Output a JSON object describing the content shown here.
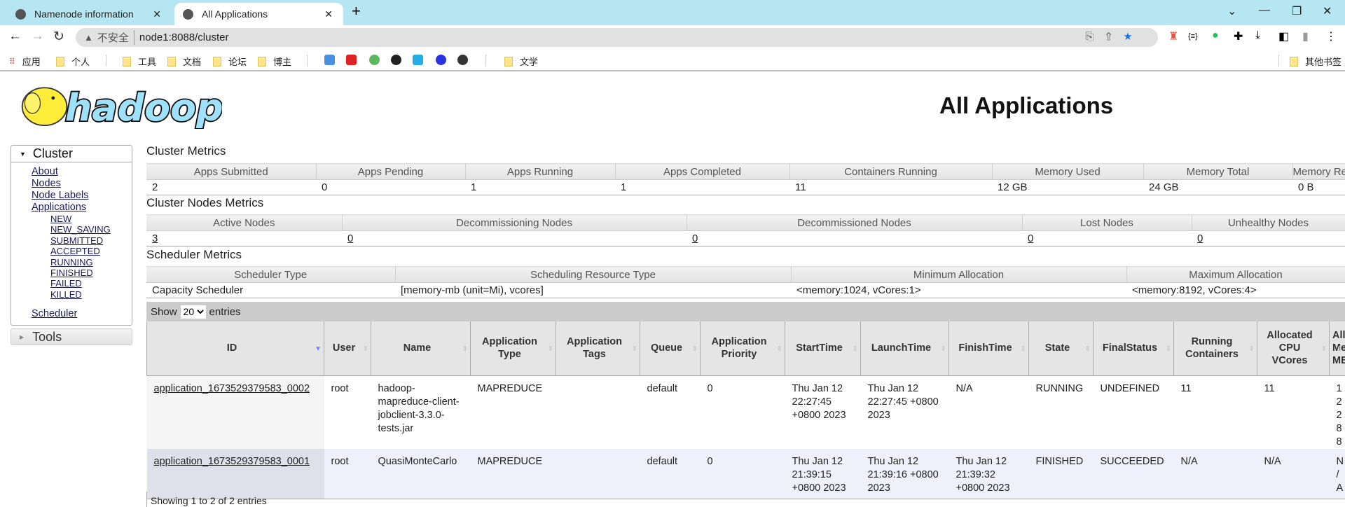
{
  "browser": {
    "tabs": [
      {
        "title": "Namenode information"
      },
      {
        "title": "All Applications",
        "active": true
      }
    ],
    "insecure_label": "不安全",
    "url": "node1:8088/cluster",
    "bookmarks": [
      "应用",
      "个人",
      "工具",
      "文档",
      "论坛",
      "博主",
      "文学"
    ],
    "other_bookmarks": "其他书签"
  },
  "page": {
    "title": "All Applications",
    "logo_text": "hadoop"
  },
  "sidebar": {
    "cluster_label": "Cluster",
    "links": [
      "About",
      "Nodes",
      "Node Labels",
      "Applications"
    ],
    "app_states": [
      "NEW",
      "NEW_SAVING",
      "SUBMITTED",
      "ACCEPTED",
      "RUNNING",
      "FINISHED",
      "FAILED",
      "KILLED"
    ],
    "scheduler": "Scheduler",
    "tools_label": "Tools"
  },
  "cluster_metrics": {
    "title": "Cluster Metrics",
    "headers": [
      "Apps Submitted",
      "Apps Pending",
      "Apps Running",
      "Apps Completed",
      "Containers Running",
      "Memory Used",
      "Memory Total",
      "Memory Reserved"
    ],
    "values": [
      "2",
      "0",
      "1",
      "1",
      "11",
      "12 GB",
      "24 GB",
      "0 B"
    ]
  },
  "node_metrics": {
    "title": "Cluster Nodes Metrics",
    "headers": [
      "Active Nodes",
      "Decommissioning Nodes",
      "Decommissioned Nodes",
      "Lost Nodes",
      "Unhealthy Nodes"
    ],
    "values": [
      "3",
      "0",
      "0",
      "0",
      "0"
    ]
  },
  "scheduler_metrics": {
    "title": "Scheduler Metrics",
    "headers": [
      "Scheduler Type",
      "Scheduling Resource Type",
      "Minimum Allocation",
      "Maximum Allocation"
    ],
    "values": [
      "Capacity Scheduler",
      "[memory-mb (unit=Mi), vcores]",
      "<memory:1024, vCores:1>",
      "<memory:8192, vCores:4>"
    ]
  },
  "apps": {
    "show_label": "Show",
    "entries_label": "entries",
    "page_size": "20",
    "headers": [
      "ID",
      "User",
      "Name",
      "Application Type",
      "Application Tags",
      "Queue",
      "Application Priority",
      "StartTime",
      "LaunchTime",
      "FinishTime",
      "State",
      "FinalStatus",
      "Running Containers",
      "Allocated CPU VCores",
      "Allocated Memory MB"
    ],
    "rows": [
      [
        "application_1673529379583_0002",
        "root",
        "hadoop-mapreduce-client-jobclient-3.3.0-tests.jar",
        "MAPREDUCE",
        "",
        "default",
        "0",
        "Thu Jan 12 22:27:45 +0800 2023",
        "Thu Jan 12 22:27:45 +0800 2023",
        "N/A",
        "RUNNING",
        "UNDEFINED",
        "11",
        "11",
        "12288"
      ],
      [
        "application_1673529379583_0001",
        "root",
        "QuasiMonteCarlo",
        "MAPREDUCE",
        "",
        "default",
        "0",
        "Thu Jan 12 21:39:15 +0800 2023",
        "Thu Jan 12 21:39:16 +0800 2023",
        "Thu Jan 12 21:39:32 +0800 2023",
        "FINISHED",
        "SUCCEEDED",
        "N/A",
        "N/A",
        "N/A"
      ]
    ],
    "footer": "Showing 1 to 2 of 2 entries"
  }
}
